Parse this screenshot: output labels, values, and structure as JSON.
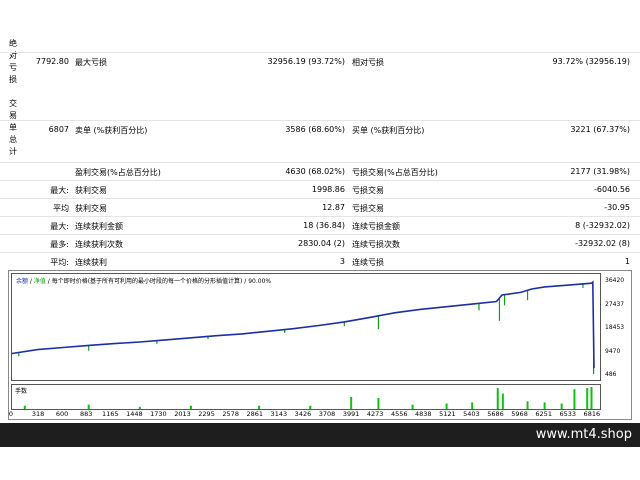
{
  "sections": {
    "absolute_drawdown_label": "绝对亏损",
    "trades_total_label": "交易单总计"
  },
  "stats": {
    "row1": {
      "abs_value": "7792.80",
      "max_label": "最大亏损",
      "max_value": "32956.19 (93.72%)",
      "rel_label": "相对亏损",
      "rel_value": "93.72% (32956.19)"
    },
    "row2": {
      "total_value": "6807",
      "short_label": "卖单 (%获利百分比)",
      "short_value": "3586 (68.60%)",
      "long_label": "买单 (%获利百分比)",
      "long_value": "3221 (67.37%)"
    },
    "row3": {
      "profit_label": "盈利交易(%占总百分比)",
      "profit_value": "4630 (68.02%)",
      "loss_label": "亏损交易(%占总百分比)",
      "loss_value": "2177 (31.98%)"
    },
    "row4": {
      "prefix": "最大:",
      "label1": "获利交易",
      "value1": "1998.86",
      "label2": "亏损交易",
      "value2": "-6040.56"
    },
    "row5": {
      "prefix": "平均",
      "label1": "获利交易",
      "value1": "12.87",
      "label2": "亏损交易",
      "value2": "-30.95"
    },
    "row6": {
      "prefix": "最大:",
      "label1": "连续获利金额",
      "value1": "18 (36.84)",
      "label2": "连续亏损金额",
      "value2": "8 (-32932.02)"
    },
    "row7": {
      "prefix": "最多:",
      "label1": "连续获利次数",
      "value1": "2830.04 (2)",
      "label2": "连续亏损次数",
      "value2": "-32932.02 (8)"
    },
    "row8": {
      "prefix": "平均:",
      "label1": "连续获利",
      "value1": "3",
      "label2": "连续亏损",
      "value2": "1"
    }
  },
  "chart_data": {
    "type": "line",
    "legend": {
      "balance": "余额",
      "equity": "净值",
      "text": "每个即时价格(基于所有可利用的最小时段的每一个价格的分形插值计算) / 90.00%"
    },
    "volume_label": "手数",
    "y_ticks": [
      "36420",
      "27437",
      "18453",
      "9470",
      "486"
    ],
    "ylim": [
      486,
      38000
    ],
    "x_ticks": [
      "0",
      "318",
      "600",
      "883",
      "1165",
      "1448",
      "1730",
      "2013",
      "2295",
      "2578",
      "2861",
      "3143",
      "3426",
      "3708",
      "3991",
      "4273",
      "4556",
      "4838",
      "5121",
      "5403",
      "5686",
      "5968",
      "6251",
      "6533",
      "6816"
    ],
    "xlim": [
      0,
      6900
    ],
    "series": [
      {
        "name": "余额",
        "color": "#1a2fa8",
        "x": [
          0,
          300,
          600,
          900,
          1200,
          1500,
          1800,
          2100,
          2400,
          2700,
          3000,
          3300,
          3600,
          3900,
          4200,
          4500,
          4800,
          5100,
          5400,
          5686,
          5750,
          5968,
          6100,
          6251,
          6533,
          6800,
          6816,
          6830
        ],
        "y": [
          9100,
          10600,
          11400,
          12200,
          12900,
          13500,
          14300,
          15100,
          15900,
          16600,
          17600,
          18600,
          19800,
          21200,
          22900,
          24700,
          26000,
          27000,
          28000,
          29000,
          31500,
          32500,
          33800,
          34600,
          35300,
          36000,
          36420,
          3500
        ]
      }
    ],
    "equity_dips": [
      {
        "x": 80,
        "y": 8000
      },
      {
        "x": 900,
        "y": 10200
      },
      {
        "x": 1700,
        "y": 12800
      },
      {
        "x": 2300,
        "y": 14600
      },
      {
        "x": 3200,
        "y": 17000
      },
      {
        "x": 3900,
        "y": 19600
      },
      {
        "x": 4300,
        "y": 18400
      },
      {
        "x": 5480,
        "y": 25600
      },
      {
        "x": 5720,
        "y": 21600
      },
      {
        "x": 5780,
        "y": 27500
      },
      {
        "x": 6050,
        "y": 29500
      },
      {
        "x": 6700,
        "y": 34200
      },
      {
        "x": 6825,
        "y": 1200
      }
    ],
    "volume_spikes": [
      {
        "x": 150,
        "v": 0.15
      },
      {
        "x": 900,
        "v": 0.2
      },
      {
        "x": 1500,
        "v": 0.1
      },
      {
        "x": 2100,
        "v": 0.15
      },
      {
        "x": 2900,
        "v": 0.15
      },
      {
        "x": 3500,
        "v": 0.15
      },
      {
        "x": 3980,
        "v": 0.55
      },
      {
        "x": 4300,
        "v": 0.5
      },
      {
        "x": 4700,
        "v": 0.2
      },
      {
        "x": 5100,
        "v": 0.25
      },
      {
        "x": 5400,
        "v": 0.3
      },
      {
        "x": 5700,
        "v": 0.95
      },
      {
        "x": 5760,
        "v": 0.7
      },
      {
        "x": 6050,
        "v": 0.35
      },
      {
        "x": 6250,
        "v": 0.3
      },
      {
        "x": 6450,
        "v": 0.25
      },
      {
        "x": 6600,
        "v": 0.9
      },
      {
        "x": 6750,
        "v": 0.95
      },
      {
        "x": 6800,
        "v": 1.0
      }
    ]
  },
  "brand": "www.mt4.shop"
}
